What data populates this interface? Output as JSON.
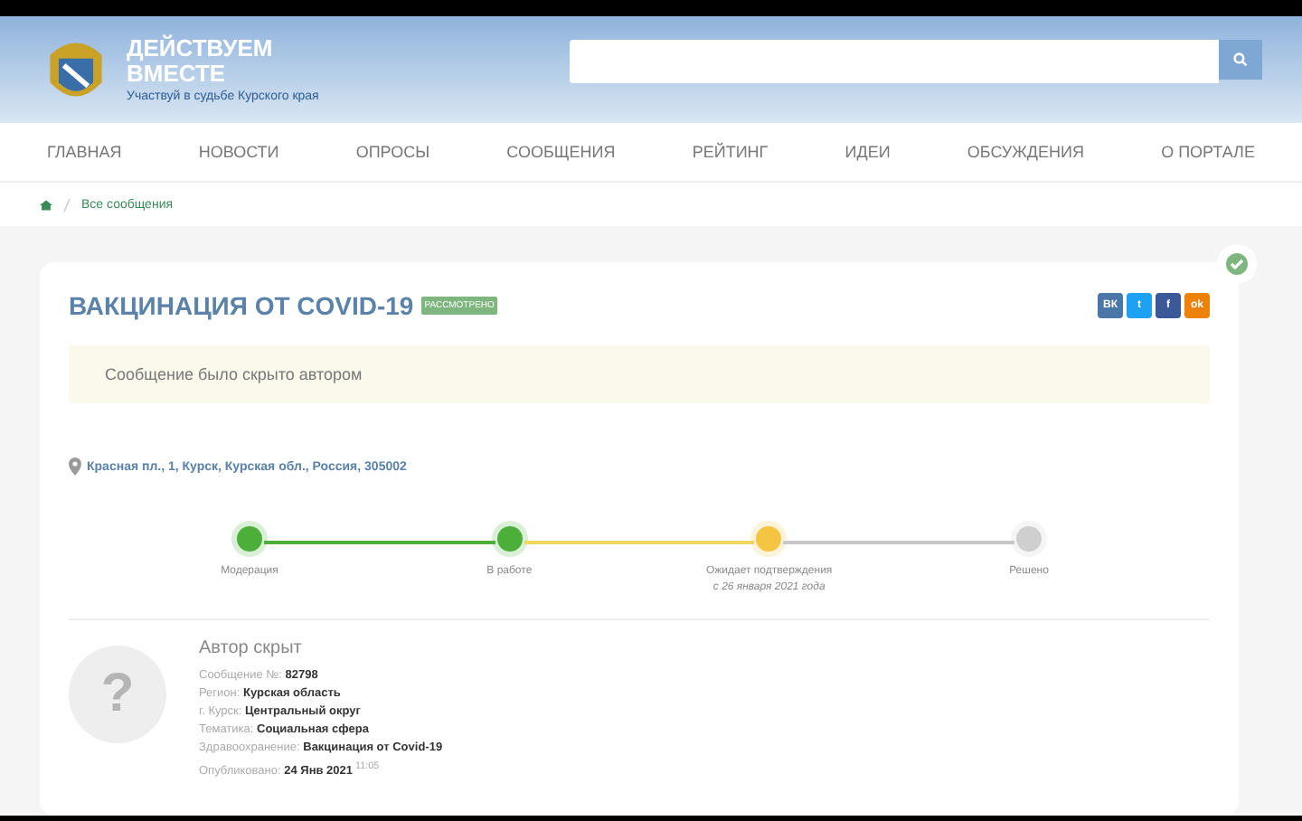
{
  "header": {
    "title_line1": "ДЕЙСТВУЕМ",
    "title_line2": "ВМЕСТЕ",
    "subtitle": "Участвуй в судьбе Курского края"
  },
  "nav": [
    "ГЛАВНАЯ",
    "НОВОСТИ",
    "ОПРОСЫ",
    "СООБЩЕНИЯ",
    "РЕЙТИНГ",
    "ИДЕИ",
    "ОБСУЖДЕНИЯ",
    "О ПОРТАЛЕ"
  ],
  "breadcrumb": [
    "Все сообщения"
  ],
  "message": {
    "title": "ВАКЦИНАЦИЯ ОТ COVID-19",
    "badge": "РАССМОТРЕНО",
    "checked": true,
    "notice": "Сообщение было скрыто автором",
    "address": "Красная пл., 1, Курск, Курская обл., Россия, 305002",
    "social": [
      {
        "label": "ВК",
        "color": "#4a76a8"
      },
      {
        "label": "t",
        "color": "#1da1f2"
      },
      {
        "label": "f",
        "color": "#3b5998"
      },
      {
        "label": "ok",
        "color": "#ee8208"
      }
    ],
    "steps": [
      {
        "label": "Модерация",
        "kind": "done"
      },
      {
        "label": "В работе",
        "kind": "done"
      },
      {
        "label": "Ожидает подтверждения",
        "kind": "current",
        "note": "с 26 января 2021 года"
      },
      {
        "label": "Решено",
        "kind": "pending"
      }
    ],
    "avatar_symbol": "?",
    "author": "Автор скрыт",
    "details": [
      {
        "label": "Сообщение №:",
        "value": "82798"
      },
      {
        "label": "Регион:",
        "value": "Курская область"
      },
      {
        "label": "г. Курск:",
        "value": "Центральный округ"
      },
      {
        "label": "Тематика:",
        "value": "Социальная сфера"
      },
      {
        "label": "Здравоохранение:",
        "value": "Вакцинация от Covid-19"
      },
      {
        "label": "Опубликовано:",
        "value": "24 Янв 2021",
        "time": "11:05"
      }
    ]
  }
}
